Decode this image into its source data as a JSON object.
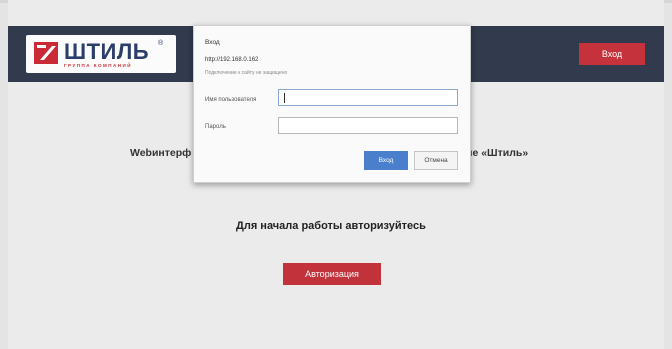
{
  "header": {
    "logo_text": "ШТИЛЬ",
    "logo_registered": "®",
    "logo_subtitle": "ГРУППА КОМПАНИЙ",
    "login_button": "Вход"
  },
  "main": {
    "web_title_left": "Webинтерф",
    "web_title_right": "ие «Штиль»",
    "start_text": "Для начала работы авторизуйтесь",
    "auth_button": "Авторизация"
  },
  "dialog": {
    "title": "Вход",
    "url": "http://192.168.0.162",
    "warning": "Подключение к сайту не защищено",
    "username_label": "Имя пользователя",
    "password_label": "Пароль",
    "username_value": "",
    "password_value": "",
    "ok_button": "Вход",
    "cancel_button": "Отмена"
  },
  "colors": {
    "header_bg": "#323a4d",
    "accent_red": "#c6323b",
    "ok_blue": "#4a7fcc"
  }
}
